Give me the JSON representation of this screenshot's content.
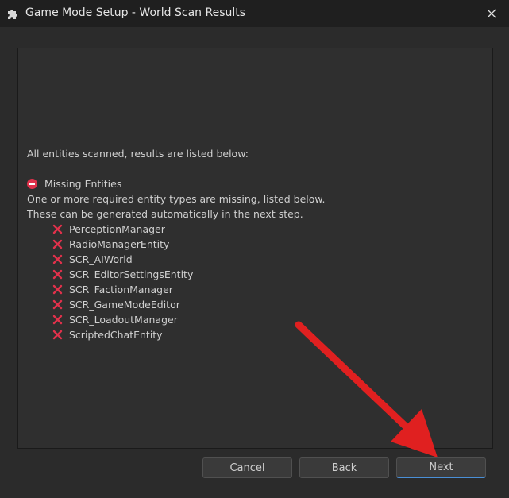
{
  "window": {
    "title": "Game Mode Setup - World Scan Results",
    "icon": "puzzle-piece-icon",
    "close_icon": "close-icon"
  },
  "content": {
    "intro": "All entities scanned, results are listed below:",
    "missing_header": "Missing Entities",
    "missing_icon": "no-entry-icon",
    "description_line1": "One or more required entity types are missing, listed below.",
    "description_line2": "These can be generated automatically in the next step.",
    "entities": [
      "PerceptionManager",
      "RadioManagerEntity",
      "SCR_AIWorld",
      "SCR_EditorSettingsEntity",
      "SCR_FactionManager",
      "SCR_GameModeEditor",
      "SCR_LoadoutManager",
      "ScriptedChatEntity"
    ],
    "entity_icon": "red-x-icon"
  },
  "footer": {
    "cancel_label": "Cancel",
    "back_label": "Back",
    "next_label": "Next"
  },
  "colors": {
    "accent": "#4a8fd6",
    "error": "#e0314b",
    "annotation_arrow": "#e02020"
  }
}
